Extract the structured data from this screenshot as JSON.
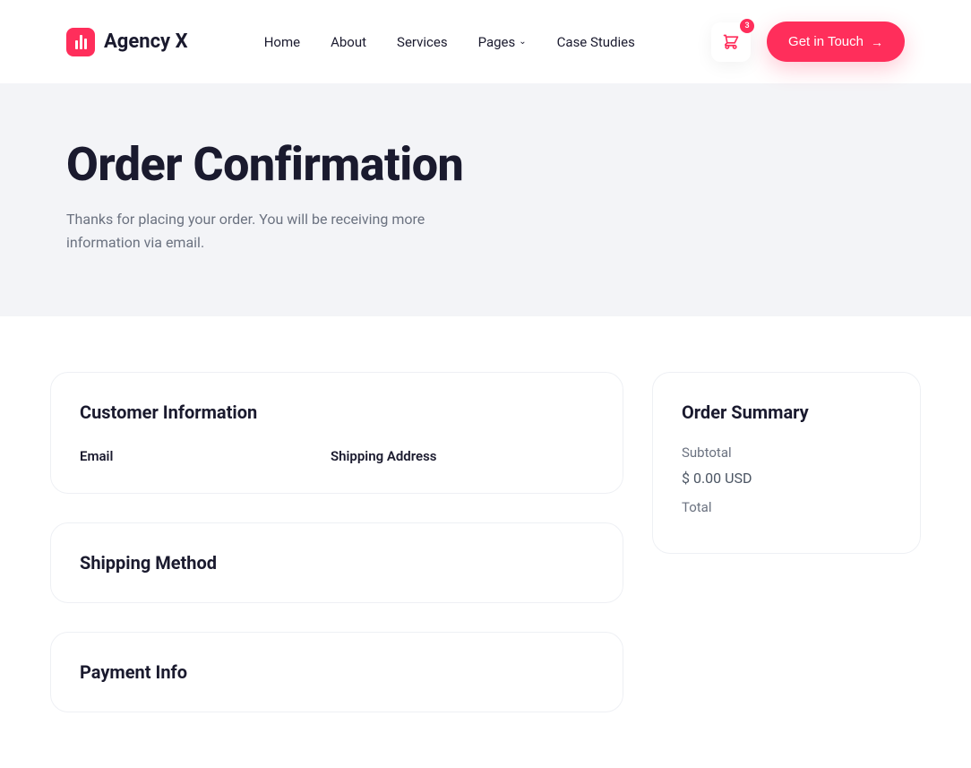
{
  "brand": {
    "name": "Agency X"
  },
  "nav": {
    "items": [
      {
        "label": "Home"
      },
      {
        "label": "About"
      },
      {
        "label": "Services"
      },
      {
        "label": "Pages",
        "dropdown": true
      },
      {
        "label": "Case Studies"
      }
    ]
  },
  "cart": {
    "count": "3"
  },
  "cta": {
    "label": "Get in Touch"
  },
  "hero": {
    "title": "Order Confirmation",
    "subtitle": "Thanks for placing your order. You will be receiving more information via email."
  },
  "customer_info": {
    "title": "Customer Information",
    "email_label": "Email",
    "shipping_label": "Shipping Address"
  },
  "shipping_method": {
    "title": "Shipping Method"
  },
  "payment_info": {
    "title": "Payment Info"
  },
  "order_summary": {
    "title": "Order Summary",
    "subtotal_label": "Subtotal",
    "subtotal_value": "$ 0.00 USD",
    "total_label": "Total"
  }
}
